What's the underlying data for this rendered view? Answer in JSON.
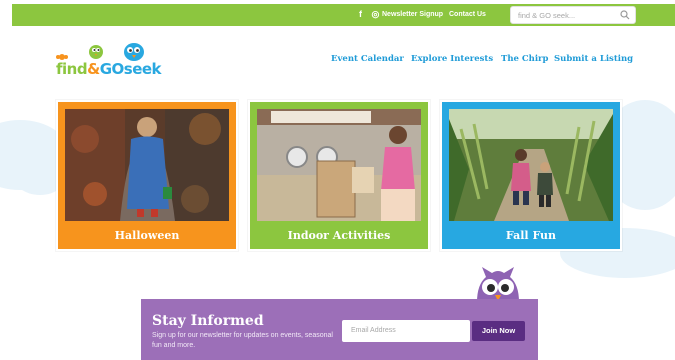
{
  "topbar": {
    "social": [
      {
        "name": "facebook-icon",
        "glyph": "f"
      },
      {
        "name": "instagram-icon",
        "glyph": "◎"
      }
    ],
    "newsletter_link": "Newsletter Signup",
    "contact_link": "Contact Us",
    "search_placeholder": "find & GO seek..."
  },
  "logo": {
    "part1": "find",
    "part2": "&",
    "part3": "GO",
    "part4": "seek"
  },
  "nav": {
    "items": [
      "Event Calendar",
      "Explore Interests",
      "The Chirp",
      "Submit a Listing"
    ]
  },
  "cards": [
    {
      "label": "Halloween",
      "color": "#f7941d"
    },
    {
      "label": "Indoor Activities",
      "color": "#8cc63f"
    },
    {
      "label": "Fall Fun",
      "color": "#27a8e1"
    }
  ],
  "newsletter": {
    "title": "Stay Informed",
    "subtitle": "Sign up for our newsletter for updates on events, seasonal fun and more.",
    "email_placeholder": "Email Address",
    "button": "Join Now"
  },
  "colors": {
    "green": "#8cc63f",
    "orange": "#f7941d",
    "blue": "#27a8e1",
    "purple": "#9c6fb8",
    "dark_purple": "#5a2d82"
  }
}
